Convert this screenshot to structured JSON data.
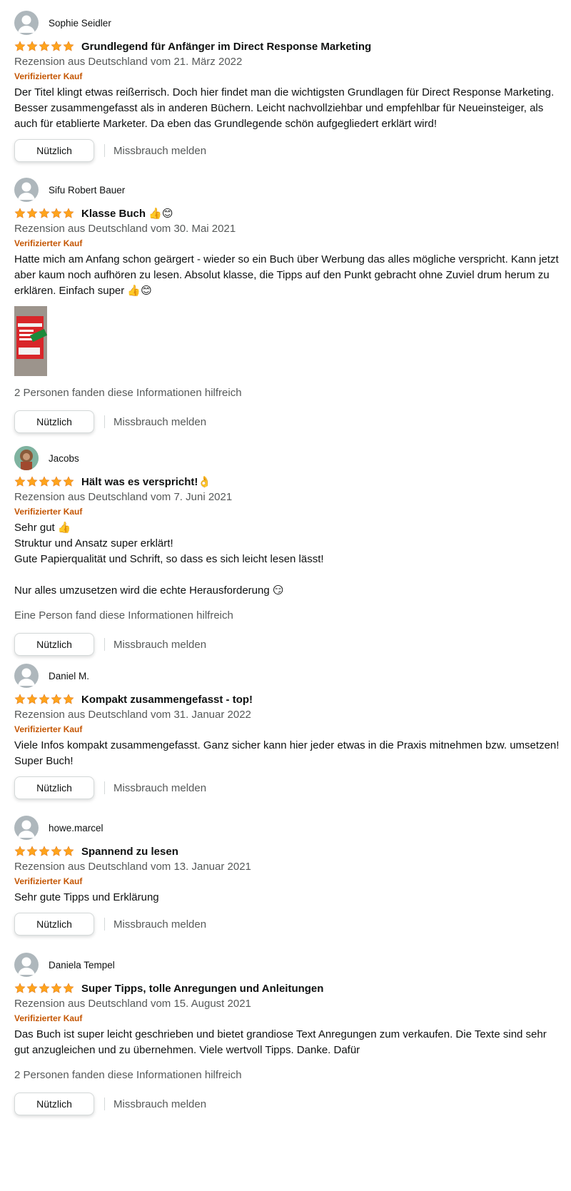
{
  "reviews": [
    {
      "author": "Sophie Seidler",
      "rating": 5,
      "title": "Grundlegend für Anfänger im Direct Response Marketing",
      "meta": "Rezension aus Deutschland vom 21. März 2022",
      "verified": "Verifizierter Kauf",
      "body": [
        "Der Titel klingt etwas reißerrisch. Doch hier findet man die wichtigsten Grundlagen für Direct Response Marketing. Besser zusammengefasst als in anderen Büchern. Leicht nachvollziehbar und empfehlbar für Neueinsteiger, als auch für etablierte Marketer. Da eben das Grundlegende schön aufgegliedert erklärt wird!"
      ],
      "helpful": "",
      "useful_label": "Nützlich",
      "report_label": "Missbrauch melden"
    },
    {
      "author": "Sifu Robert Bauer",
      "rating": 5,
      "title": "Klasse Buch 👍😊",
      "meta": "Rezension aus Deutschland vom 30. Mai 2021",
      "verified": "Verifizierter Kauf",
      "body": [
        "Hatte mich am Anfang schon geärgert - wieder so ein Buch über Werbung das alles mögliche verspricht. Kann jetzt aber kaum noch aufhören zu lesen. Absolut klasse, die Tipps auf den Punkt gebracht ohne Zuviel drum herum zu erklären. Einfach super 👍😊"
      ],
      "helpful": "2 Personen fanden diese Informationen hilfreich",
      "useful_label": "Nützlich",
      "report_label": "Missbrauch melden"
    },
    {
      "author": "Jacobs",
      "rating": 5,
      "title": "Hält was es verspricht!👌",
      "meta": "Rezension aus Deutschland vom 7. Juni 2021",
      "verified": "Verifizierter Kauf",
      "body": [
        "Sehr gut 👍",
        "Struktur und Ansatz super erklärt!",
        "Gute Papierqualität und Schrift, so dass es sich leicht lesen lässt!",
        "",
        "Nur alles umzusetzen wird die echte Herausforderung 😏"
      ],
      "helpful": "Eine Person fand diese Informationen hilfreich",
      "useful_label": "Nützlich",
      "report_label": "Missbrauch melden"
    },
    {
      "author": "Daniel M.",
      "rating": 5,
      "title": "Kompakt zusammengefasst - top!",
      "meta": "Rezension aus Deutschland vom 31. Januar 2022",
      "verified": "Verifizierter Kauf",
      "body": [
        "Viele Infos kompakt zusammengefasst. Ganz sicher kann hier jeder etwas in die Praxis mitnehmen bzw. umsetzen! Super Buch!"
      ],
      "helpful": "",
      "useful_label": "Nützlich",
      "report_label": "Missbrauch melden"
    },
    {
      "author": "howe.marcel",
      "rating": 5,
      "title": "Spannend zu lesen",
      "meta": "Rezension aus Deutschland vom 13. Januar 2021",
      "verified": "Verifizierter Kauf",
      "body": [
        "Sehr gute Tipps und Erklärung"
      ],
      "helpful": "",
      "useful_label": "Nützlich",
      "report_label": "Missbrauch melden"
    },
    {
      "author": "Daniela Tempel",
      "rating": 5,
      "title": "Super Tipps, tolle Anregungen und Anleitungen",
      "meta": "Rezension aus Deutschland vom 15. August 2021",
      "verified": "Verifizierter Kauf",
      "body": [
        "Das Buch ist super leicht geschrieben und bietet grandiose Text Anregungen zum verkaufen. Die Texte sind sehr gut anzugleichen und zu übernehmen. Viele wertvoll Tipps. Danke. Dafür"
      ],
      "helpful": "2 Personen fanden diese Informationen hilfreich",
      "useful_label": "Nützlich",
      "report_label": "Missbrauch melden"
    }
  ],
  "colors": {
    "star": "#ffa41c",
    "verified": "#c45500",
    "muted": "#565959",
    "avatar": "#aeb7bc"
  },
  "icons": {
    "star": "star-icon",
    "avatar": "avatar-icon",
    "review_image": "review-image"
  }
}
